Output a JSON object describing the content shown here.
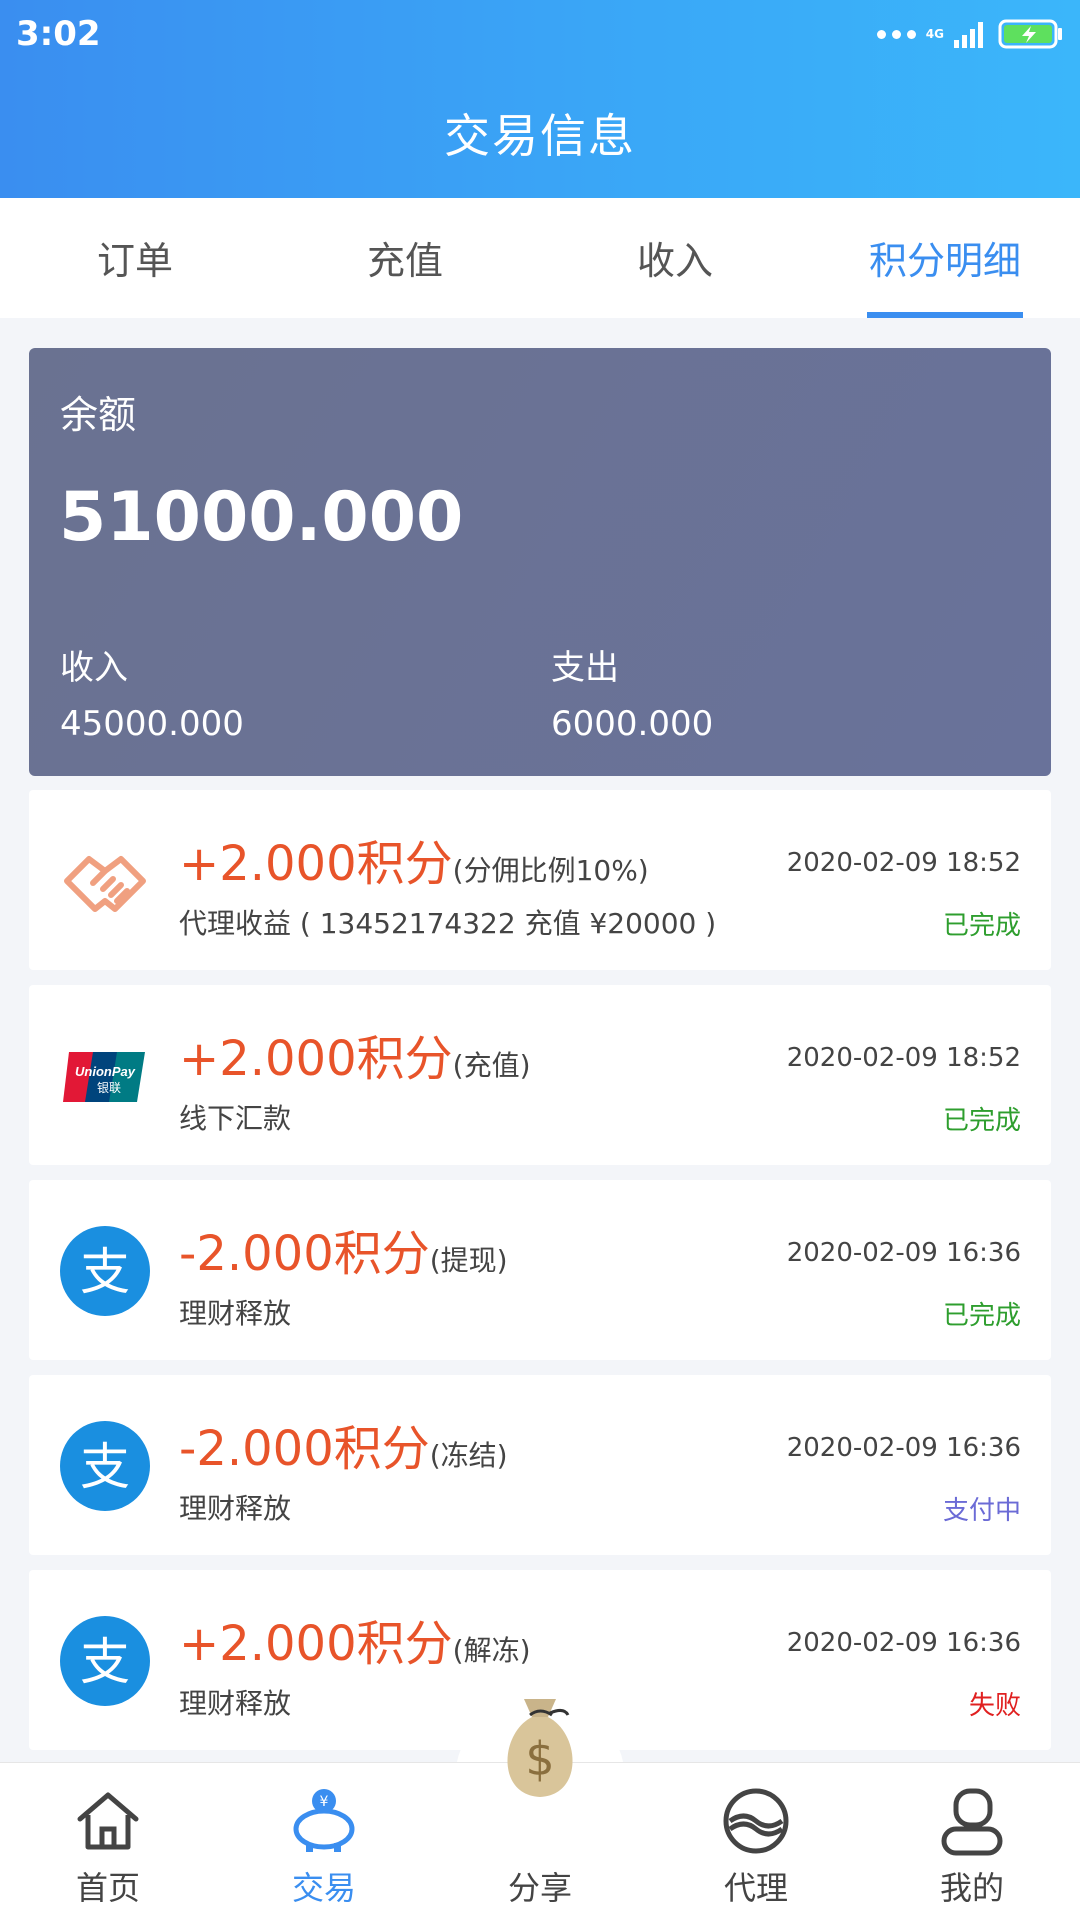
{
  "status_bar": {
    "time": "3:02",
    "network": "4G"
  },
  "header": {
    "title": "交易信息"
  },
  "tabs": [
    {
      "label": "订单",
      "active": false
    },
    {
      "label": "充值",
      "active": false
    },
    {
      "label": "收入",
      "active": false
    },
    {
      "label": "积分明细",
      "active": true
    }
  ],
  "balance": {
    "label": "余额",
    "amount": "51000.000",
    "income_label": "收入",
    "income": "45000.000",
    "expense_label": "支出",
    "expense": "6000.000"
  },
  "transactions": [
    {
      "icon": "handshake-icon",
      "amount": "+2.000积分",
      "note": "(分佣比例10%)",
      "desc": "代理收益 ( 13452174322 充值 ¥20000 )",
      "time": "2020-02-09 18:52",
      "status": "已完成",
      "status_color": "#2e9e2e"
    },
    {
      "icon": "unionpay-icon",
      "amount": "+2.000积分",
      "note": "(充值)",
      "desc": "线下汇款",
      "time": "2020-02-09 18:52",
      "status": "已完成",
      "status_color": "#2e9e2e"
    },
    {
      "icon": "alipay-icon",
      "amount": "-2.000积分",
      "note": "(提现)",
      "desc": "理财释放",
      "time": "2020-02-09 16:36",
      "status": "已完成",
      "status_color": "#2e9e2e"
    },
    {
      "icon": "alipay-icon",
      "amount": "-2.000积分",
      "note": "(冻结)",
      "desc": "理财释放",
      "time": "2020-02-09 16:36",
      "status": "支付中",
      "status_color": "#6b6bd6"
    },
    {
      "icon": "alipay-icon",
      "amount": "+2.000积分",
      "note": "(解冻)",
      "desc": "理财释放",
      "time": "2020-02-09 16:36",
      "status": "失败",
      "status_color": "#e02020"
    }
  ],
  "bottom_nav": [
    {
      "label": "首页",
      "icon": "home-icon",
      "active": false
    },
    {
      "label": "交易",
      "icon": "piggy-bank-icon",
      "active": true
    },
    {
      "label": "分享",
      "icon": "money-bag-icon",
      "active": false
    },
    {
      "label": "代理",
      "icon": "agent-icon",
      "active": false
    },
    {
      "label": "我的",
      "icon": "user-icon",
      "active": false
    }
  ],
  "colors": {
    "primary": "#3a8ef0",
    "amount": "#e8542a",
    "card": "#6a7291"
  }
}
